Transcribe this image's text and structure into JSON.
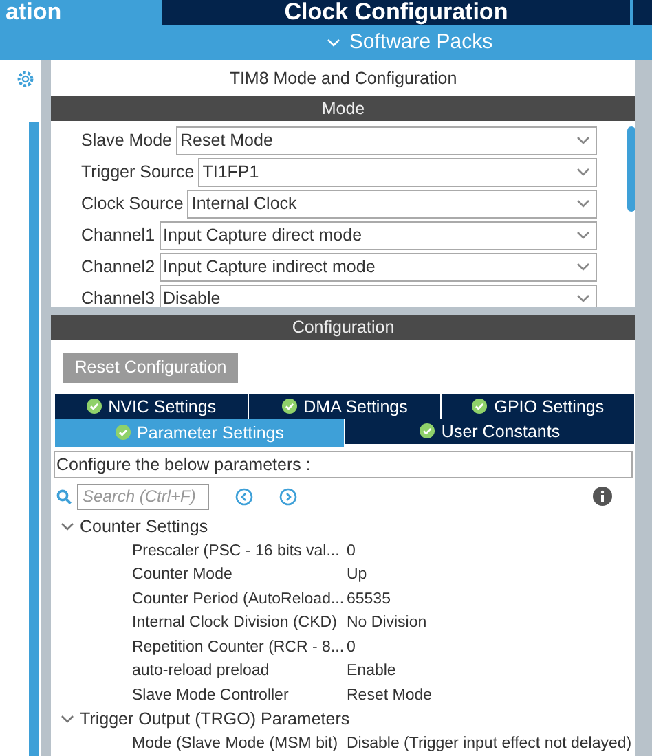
{
  "top_tabs": [
    {
      "label": "ation",
      "selected": true
    },
    {
      "label": "Clock Configuration",
      "selected": false
    }
  ],
  "sub_bar": {
    "label": "Software Packs"
  },
  "panel_title": "TIM8 Mode and Configuration",
  "mode": {
    "header": "Mode",
    "fields": [
      {
        "label": "Slave Mode",
        "value": "Reset Mode"
      },
      {
        "label": "Trigger Source",
        "value": "TI1FP1"
      },
      {
        "label": "Clock Source",
        "value": "Internal Clock"
      },
      {
        "label": "Channel1",
        "value": "Input Capture direct mode"
      },
      {
        "label": "Channel2",
        "value": "Input Capture indirect mode"
      },
      {
        "label": "Channel3",
        "value": "Disable"
      }
    ]
  },
  "configuration": {
    "header": "Configuration",
    "reset_button": "Reset Configuration",
    "tabs": [
      [
        {
          "label": "NVIC Settings",
          "selected": false
        },
        {
          "label": "DMA Settings",
          "selected": false
        },
        {
          "label": "GPIO Settings",
          "selected": false
        }
      ],
      [
        {
          "label": "Parameter Settings",
          "selected": true
        },
        {
          "label": "User Constants",
          "selected": false
        }
      ]
    ],
    "description": "Configure the below parameters :",
    "search": {
      "placeholder": "Search (Ctrl+F)"
    },
    "groups": [
      {
        "label": "Counter Settings",
        "expanded": true,
        "children": [
          {
            "name": "Prescaler (PSC - 16 bits val...",
            "value": "0"
          },
          {
            "name": "Counter Mode",
            "value": "Up"
          },
          {
            "name": "Counter Period (AutoReload...",
            "value": "65535"
          },
          {
            "name": "Internal Clock Division (CKD)",
            "value": "No Division"
          },
          {
            "name": "Repetition Counter (RCR - 8...",
            "value": "0"
          },
          {
            "name": "auto-reload preload",
            "value": "Enable"
          },
          {
            "name": "Slave Mode Controller",
            "value": "Reset Mode"
          }
        ]
      },
      {
        "label": "Trigger Output (TRGO) Parameters",
        "expanded": true,
        "children": [
          {
            "name": "Mode (Slave Mode (MSM bit)",
            "value": "Disable (Trigger input effect not delayed)"
          }
        ]
      }
    ]
  }
}
